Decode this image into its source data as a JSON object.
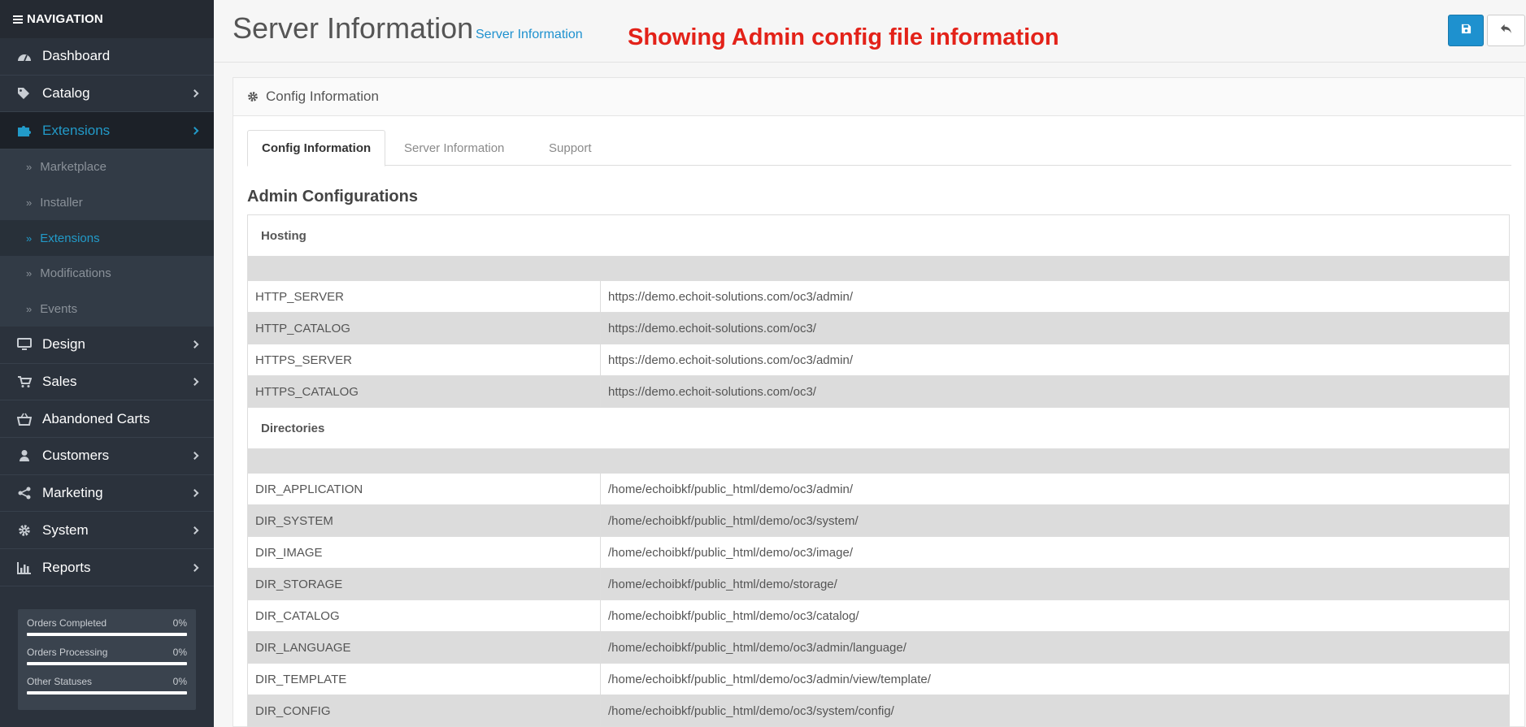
{
  "nav": {
    "header": "NAVIGATION",
    "items": [
      {
        "label": "Dashboard",
        "icon": "dashboard-icon"
      },
      {
        "label": "Catalog",
        "icon": "tags-icon"
      },
      {
        "label": "Extensions",
        "icon": "puzzle-icon"
      },
      {
        "label": "Design",
        "icon": "monitor-icon"
      },
      {
        "label": "Sales",
        "icon": "cart-icon"
      },
      {
        "label": "Abandoned Carts",
        "icon": "basket-icon"
      },
      {
        "label": "Customers",
        "icon": "user-icon"
      },
      {
        "label": "Marketing",
        "icon": "share-icon"
      },
      {
        "label": "System",
        "icon": "gear-icon"
      },
      {
        "label": "Reports",
        "icon": "bar-chart-icon"
      }
    ],
    "extensions_sub": [
      "Marketplace",
      "Installer",
      "Extensions",
      "Modifications",
      "Events"
    ]
  },
  "stats": [
    {
      "label": "Orders Completed",
      "value": "0%"
    },
    {
      "label": "Orders Processing",
      "value": "0%"
    },
    {
      "label": "Other Statuses",
      "value": "0%"
    }
  ],
  "header": {
    "title": "Server Information",
    "breadcrumb": "Server Information",
    "annotation": "Showing Admin config file information"
  },
  "panel": {
    "heading": "Config Information",
    "tabs": [
      "Config Information",
      "Server Information",
      "Support"
    ],
    "section_title": "Admin Configurations",
    "group_hosting": "Hosting",
    "group_directories": "Directories",
    "hosting_rows": [
      {
        "key": "HTTP_SERVER",
        "value": "https://demo.echoit-solutions.com/oc3/admin/"
      },
      {
        "key": "HTTP_CATALOG",
        "value": "https://demo.echoit-solutions.com/oc3/"
      },
      {
        "key": "HTTPS_SERVER",
        "value": "https://demo.echoit-solutions.com/oc3/admin/"
      },
      {
        "key": "HTTPS_CATALOG",
        "value": "https://demo.echoit-solutions.com/oc3/"
      }
    ],
    "directory_rows": [
      {
        "key": "DIR_APPLICATION",
        "value": "/home/echoibkf/public_html/demo/oc3/admin/"
      },
      {
        "key": "DIR_SYSTEM",
        "value": "/home/echoibkf/public_html/demo/oc3/system/"
      },
      {
        "key": "DIR_IMAGE",
        "value": "/home/echoibkf/public_html/demo/oc3/image/"
      },
      {
        "key": "DIR_STORAGE",
        "value": "/home/echoibkf/public_html/demo/storage/"
      },
      {
        "key": "DIR_CATALOG",
        "value": "/home/echoibkf/public_html/demo/oc3/catalog/"
      },
      {
        "key": "DIR_LANGUAGE",
        "value": "/home/echoibkf/public_html/demo/oc3/admin/language/"
      },
      {
        "key": "DIR_TEMPLATE",
        "value": "/home/echoibkf/public_html/demo/oc3/admin/view/template/"
      },
      {
        "key": "DIR_CONFIG",
        "value": "/home/echoibkf/public_html/demo/oc3/system/config/"
      }
    ]
  },
  "colors": {
    "sidebar_bg": "#2b323c",
    "accent_blue": "#1e91cf",
    "annotation_red": "#e32219",
    "row_alt": "#dcdcdc"
  }
}
